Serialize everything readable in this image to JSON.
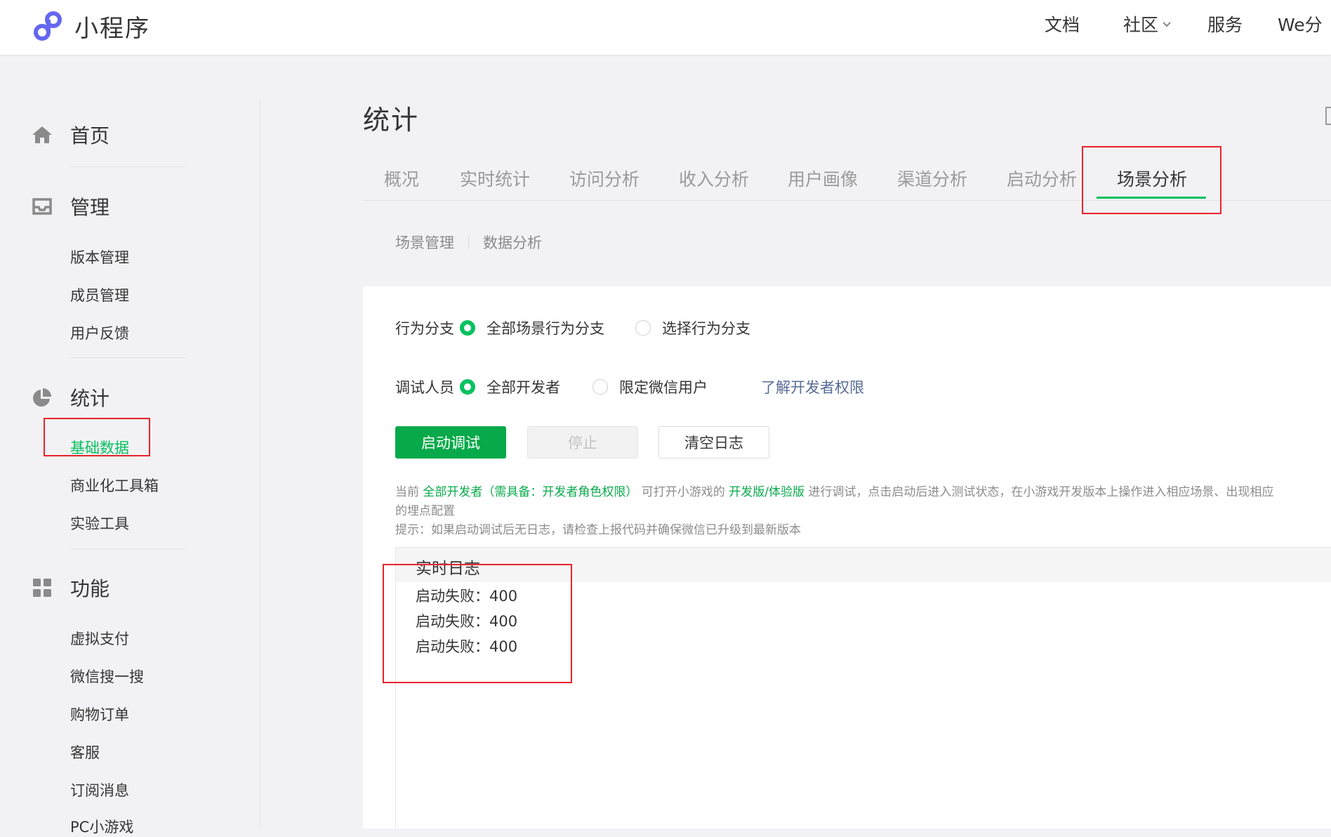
{
  "app": {
    "brand": "小程序",
    "top_nav": [
      {
        "label": "文档"
      },
      {
        "label": "社区",
        "has_dropdown": true
      },
      {
        "label": "服务"
      },
      {
        "label": "We分"
      }
    ]
  },
  "sidebar": {
    "sections": [
      {
        "label": "首页",
        "icon": "home-icon",
        "items": []
      },
      {
        "label": "管理",
        "icon": "inbox-icon",
        "items": [
          "版本管理",
          "成员管理",
          "用户反馈"
        ]
      },
      {
        "label": "统计",
        "icon": "pie-chart-icon",
        "items": [
          "基础数据",
          "商业化工具箱",
          "实验工具"
        ],
        "active_item": "基础数据"
      },
      {
        "label": "功能",
        "icon": "grid-icon",
        "items": [
          "虚拟支付",
          "微信搜一搜",
          "购物订单",
          "客服",
          "订阅消息",
          "PC小游戏"
        ]
      }
    ]
  },
  "main": {
    "title": "统计",
    "tabs": [
      "概况",
      "实时统计",
      "访问分析",
      "收入分析",
      "用户画像",
      "渠道分析",
      "启动分析",
      "场景分析"
    ],
    "active_tab": "场景分析",
    "subtabs": [
      "场景管理",
      "数据分析"
    ],
    "behavior_branch": {
      "label": "行为分支",
      "options": [
        "全部场景行为分支",
        "选择行为分支"
      ],
      "selected": "全部场景行为分支"
    },
    "debug_users": {
      "label": "调试人员",
      "options": [
        "全部开发者",
        "限定微信用户"
      ],
      "selected": "全部开发者",
      "help_link": "了解开发者权限"
    },
    "buttons": {
      "start": "启动调试",
      "stop": "停止",
      "clear": "清空日志"
    },
    "note": {
      "p1": "当前 ",
      "p2": "全部开发者（需具备：开发者角色权限）",
      "p3": " 可打开小游戏的 ",
      "p4": "开发版/体验版",
      "p5": " 进行调试，点击启动后进入测试状态，在小游戏开发版本上操作进入相应场景、出现相应",
      "line2": "的埋点配置",
      "hint": "提示：如果启动调试后无日志，请检查上报代码并确保微信已升级到最新版本"
    },
    "log": {
      "title": "实时日志",
      "lines": [
        "启动失败：400",
        "启动失败：400",
        "启动失败：400"
      ]
    }
  },
  "colors": {
    "brand_purple": "#6467f0",
    "accent_green": "#07c160",
    "button_green": "#07a94a",
    "highlight_red": "#e8232b",
    "link_blue": "#576b95"
  }
}
